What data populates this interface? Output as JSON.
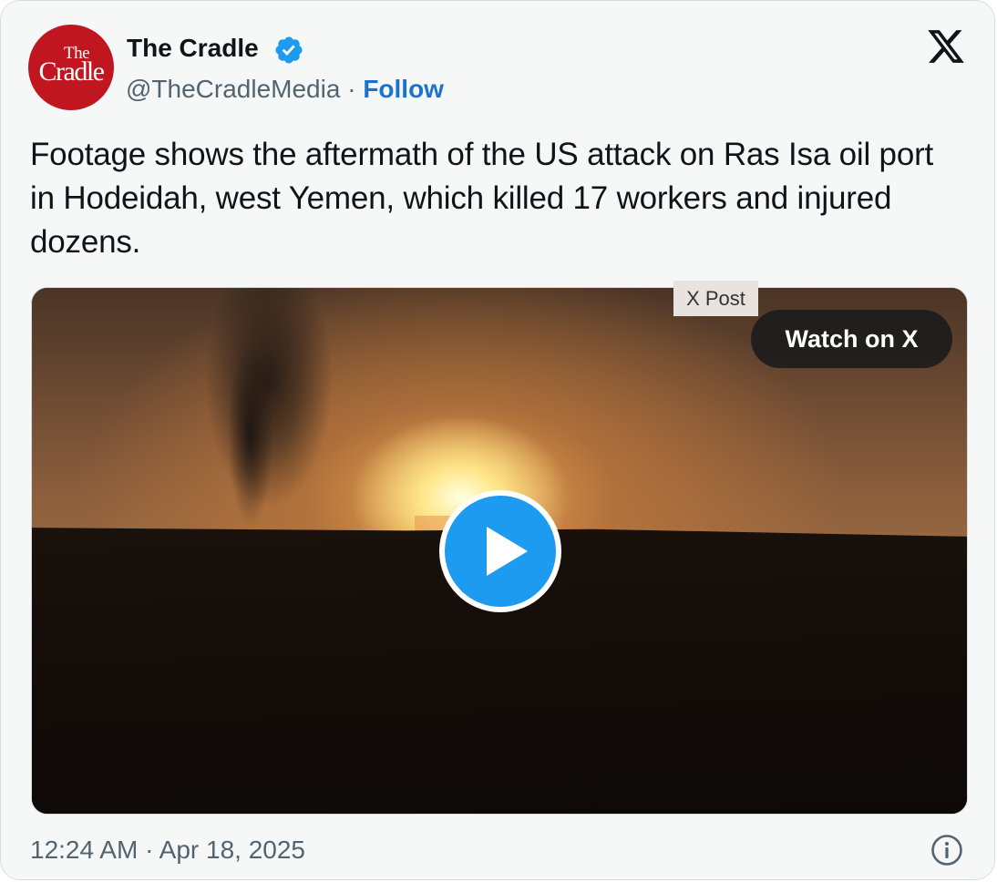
{
  "author": {
    "avatar_text_top": "The",
    "avatar_text_main": "Cradle",
    "name": "The Cradle",
    "handle": "@TheCradleMedia",
    "separator": "·",
    "follow_label": "Follow",
    "verified": true
  },
  "platform_icon": "x-logo-icon",
  "tweet": {
    "text": "Footage shows the aftermath of the US attack on Ras Isa oil port in Hodeidah, west Yemen, which killed 17 workers and injured dozens."
  },
  "media": {
    "tag_label": "X Post",
    "watch_label": "Watch on X",
    "play_icon": "play-icon"
  },
  "footer": {
    "timestamp": "12:24 AM · Apr 18, 2025",
    "info_icon": "info-icon"
  },
  "colors": {
    "brand_red": "#c0161f",
    "link_blue": "#1d72c9",
    "play_blue": "#1d9bf0",
    "text": "#0f1419",
    "muted": "#536471"
  }
}
